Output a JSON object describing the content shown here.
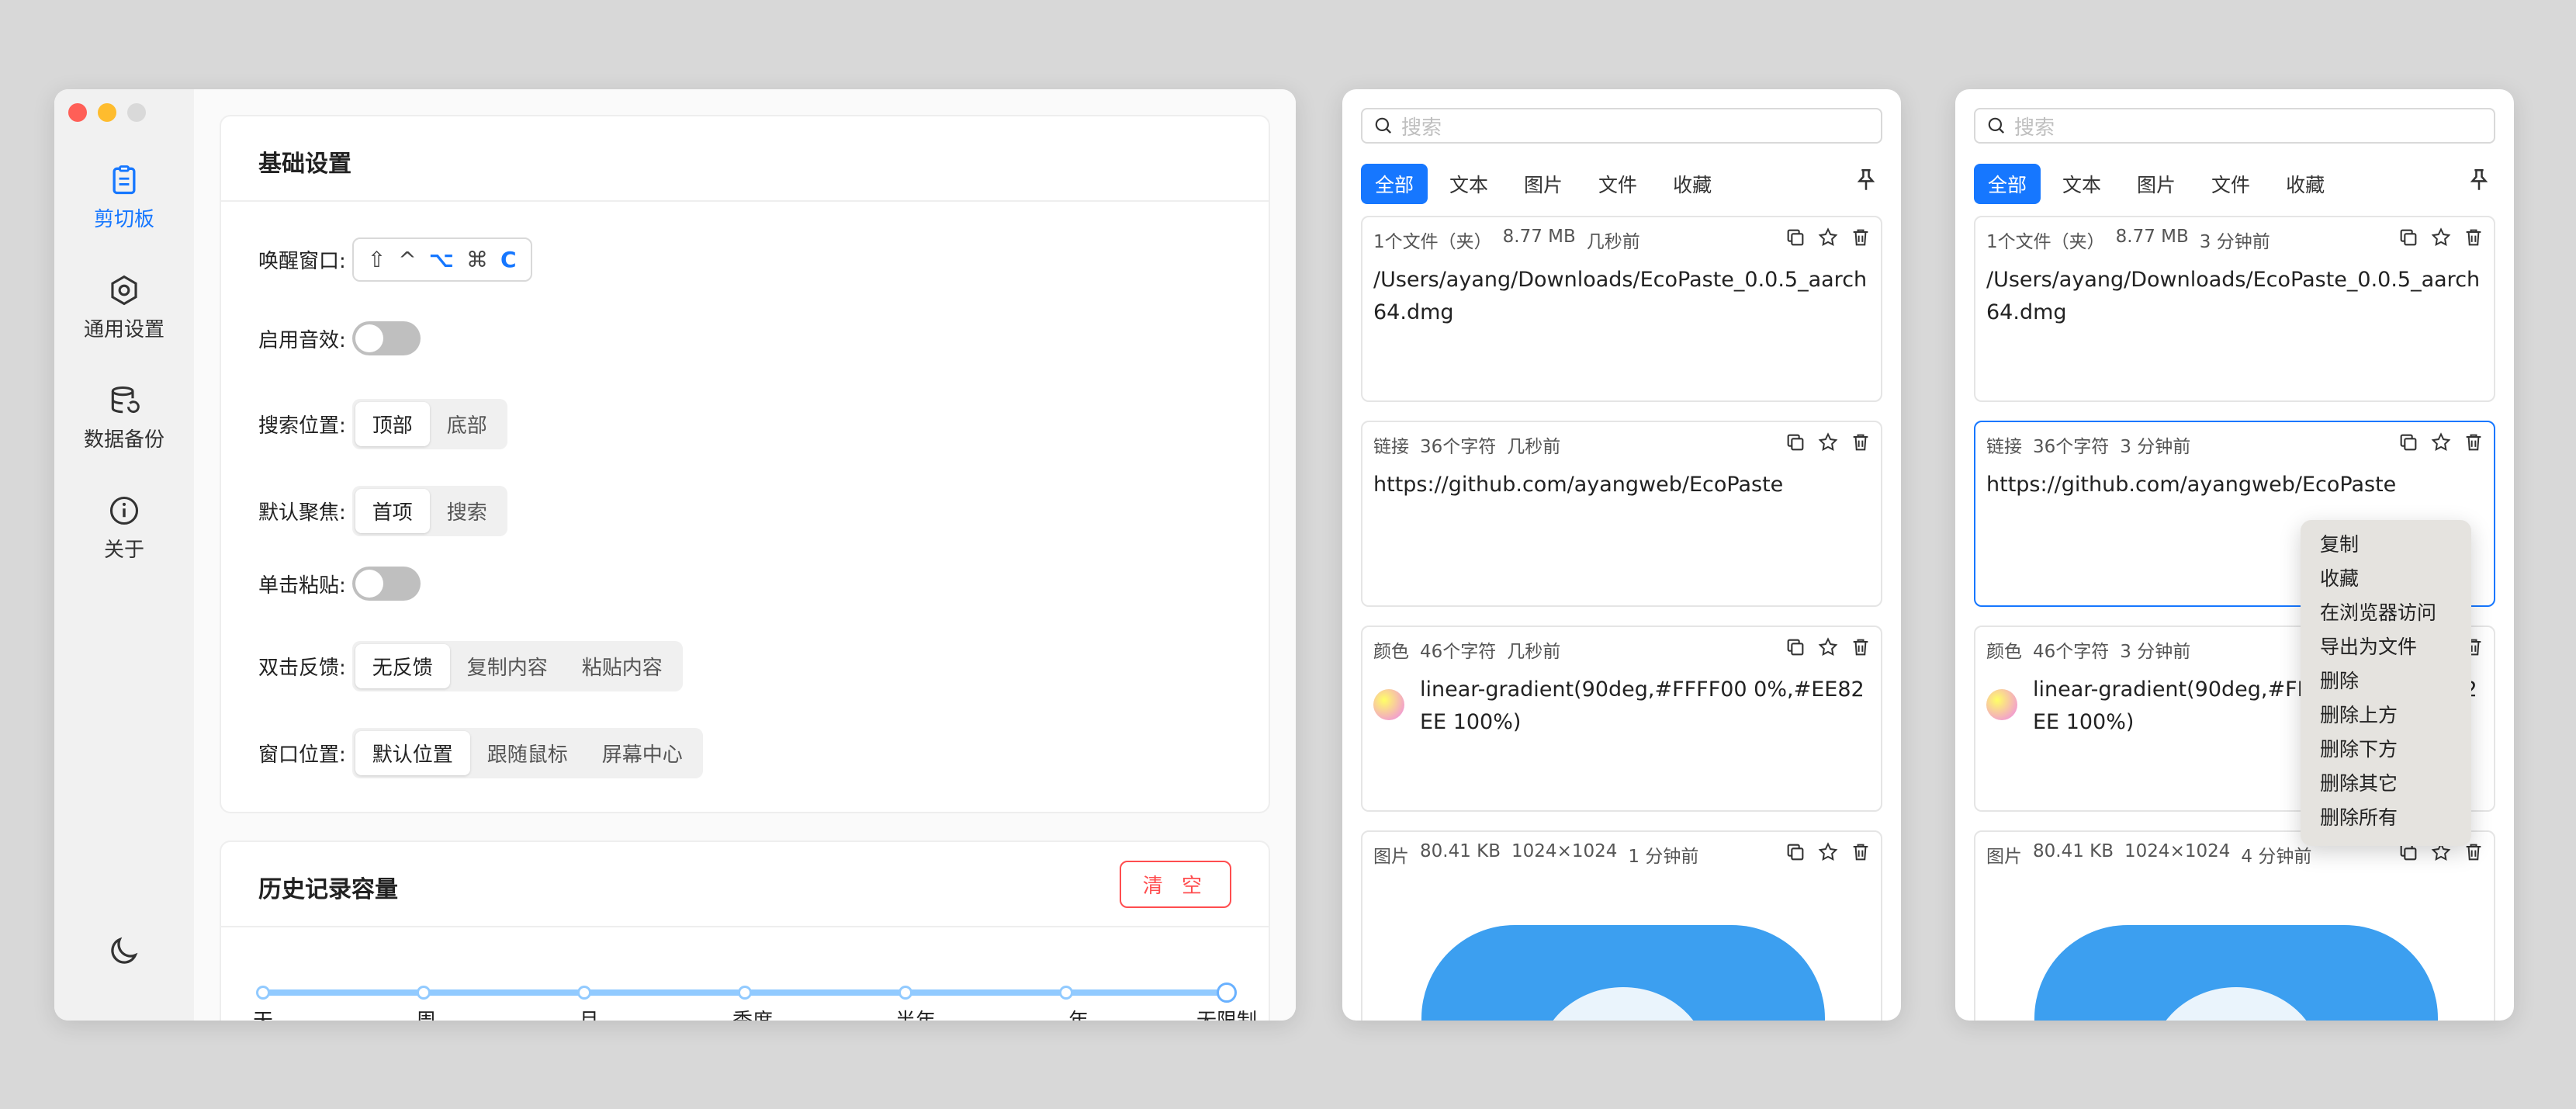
{
  "settings": {
    "sidebar": {
      "items": [
        {
          "label": "剪切板",
          "icon": "clipboard-icon",
          "active": true
        },
        {
          "label": "通用设置",
          "icon": "gear-icon"
        },
        {
          "label": "数据备份",
          "icon": "database-icon"
        },
        {
          "label": "关于",
          "icon": "info-icon"
        }
      ],
      "theme_icon": "moon-icon"
    },
    "basic": {
      "title": "基础设置",
      "wake_label": "唤醒窗口:",
      "shortcut": [
        "⇧",
        "^",
        "⌥",
        "⌘",
        "C"
      ],
      "sound_label": "启用音效:",
      "search_pos_label": "搜索位置:",
      "search_pos_options": [
        "顶部",
        "底部"
      ],
      "focus_label": "默认聚焦:",
      "focus_options": [
        "首项",
        "搜索"
      ],
      "click_paste_label": "单击粘贴:",
      "dblclick_label": "双击反馈:",
      "dblclick_options": [
        "无反馈",
        "复制内容",
        "粘贴内容"
      ],
      "window_pos_label": "窗口位置:",
      "window_pos_options": [
        "默认位置",
        "跟随鼠标",
        "屏幕中心"
      ]
    },
    "history": {
      "title": "历史记录容量",
      "clear_label": "清 空",
      "ticks": [
        "天",
        "周",
        "月",
        "季度",
        "半年",
        "年",
        "无限制"
      ],
      "selected": "无限制"
    }
  },
  "clipboard": {
    "search_placeholder": "搜索",
    "tabs": [
      "全部",
      "文本",
      "图片",
      "文件",
      "收藏"
    ],
    "left_items": [
      {
        "type": "1个文件（夹）",
        "size": "8.77 MB",
        "time": "几秒前",
        "content": "/Users/ayang/Downloads/EcoPaste_0.0.5_aarch64.dmg"
      },
      {
        "type": "链接",
        "size": "36个字符",
        "time": "几秒前",
        "content": "https://github.com/ayangweb/EcoPaste"
      },
      {
        "type": "颜色",
        "size": "46个字符",
        "time": "几秒前",
        "content": "linear-gradient(90deg,#FFFF00 0%,#EE82EE 100%)"
      },
      {
        "type": "图片",
        "size": "80.41 KB",
        "dims": "1024×1024",
        "time": "1 分钟前"
      }
    ],
    "right_items": [
      {
        "type": "1个文件（夹）",
        "size": "8.77 MB",
        "time": "3 分钟前",
        "content": "/Users/ayang/Downloads/EcoPaste_0.0.5_aarch64.dmg"
      },
      {
        "type": "链接",
        "size": "36个字符",
        "time": "3 分钟前",
        "content": "https://github.com/ayangweb/EcoPaste"
      },
      {
        "type": "颜色",
        "size": "46个字符",
        "time": "3 分钟前",
        "content": "linear-gradient(90deg,#FFFF00 0%,#EE82EE 100%)"
      },
      {
        "type": "图片",
        "size": "80.41 KB",
        "dims": "1024×1024",
        "time": "4 分钟前"
      }
    ],
    "context_menu": [
      "复制",
      "收藏",
      "在浏览器访问",
      "导出为文件",
      "删除",
      "删除上方",
      "删除下方",
      "删除其它",
      "删除所有"
    ]
  },
  "colors": {
    "accent": "#1677ff",
    "danger": "#ff4d4f",
    "close": "#ff5f57",
    "minimize": "#febc2e",
    "zoom": "#d9d9d9"
  }
}
